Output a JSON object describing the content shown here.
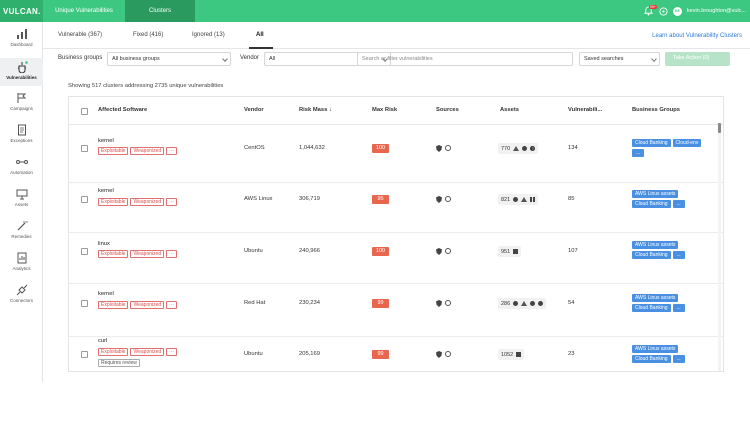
{
  "brand": {
    "logo": "VULCAN.",
    "accent": "#3dc881"
  },
  "top_tabs": [
    {
      "label": "Unique Vulnerabilities",
      "active": false
    },
    {
      "label": "Clusters",
      "active": true
    }
  ],
  "header": {
    "notification_badge": "99+",
    "avatar_initials": "KE",
    "user": "kevin.broughton@vulc..."
  },
  "sidebar": [
    {
      "label": "Dashboard",
      "icon": "bar-chart-icon",
      "active": false
    },
    {
      "label": "Vulnerabilities",
      "icon": "bug-icon",
      "active": true
    },
    {
      "label": "Campaigns",
      "icon": "flag-icon",
      "active": false
    },
    {
      "label": "Exceptions",
      "icon": "document-icon",
      "active": false
    },
    {
      "label": "Automation",
      "icon": "workflow-icon",
      "active": false
    },
    {
      "label": "Assets",
      "icon": "monitor-icon",
      "active": false
    },
    {
      "label": "Remedies",
      "icon": "wand-icon",
      "active": false
    },
    {
      "label": "Analytics",
      "icon": "report-icon",
      "active": false
    },
    {
      "label": "Connectors",
      "icon": "plug-icon",
      "active": false
    }
  ],
  "subtabs": [
    {
      "label": "Vulnerable (367)",
      "active": false
    },
    {
      "label": "Fixed (416)",
      "active": false
    },
    {
      "label": "Ignored (13)",
      "active": false
    },
    {
      "label": "All",
      "active": true
    }
  ],
  "learn_link": "Learn about Vulnerability Clusters",
  "filters": {
    "business_groups_label": "Business groups",
    "business_groups_value": "All business groups",
    "vendor_label": "Vendor",
    "vendor_value": "All",
    "search_placeholder": "Search or filter vulnerabilities",
    "saved_searches": "Saved searches",
    "take_action": "Take Action (0)"
  },
  "showing_text": "Showing 517 clusters addressing 2735 unique vulnerabilities",
  "table": {
    "columns": [
      "Affected Software",
      "Vendor",
      "Risk Mass",
      "Max Risk",
      "Sources",
      "Assets",
      "Vulnerabili...",
      "Business Groups"
    ],
    "rows": [
      {
        "software": "kernel",
        "tags": [
          "Exploitable",
          "Weaponized"
        ],
        "extra_tag": "",
        "vendor": "CentOS",
        "risk_mass": "1,044,632",
        "max_risk": "100",
        "risk_color": "#e8664e",
        "assets": "770",
        "asset_icons": [
          "tri",
          "cog",
          "q"
        ],
        "vulns": "134",
        "groups": [
          [
            "Cloud Banking",
            "Cloud-env"
          ],
          [
            "..."
          ]
        ]
      },
      {
        "software": "kernel",
        "tags": [
          "Exploitable",
          "Weaponized"
        ],
        "extra_tag": "",
        "vendor": "AWS Linux",
        "risk_mass": "306,719",
        "max_risk": "95",
        "risk_color": "#e8664e",
        "assets": "821",
        "asset_icons": [
          "circ",
          "tri",
          "win"
        ],
        "vulns": "85",
        "groups": [
          [
            "AWS Linux assets"
          ],
          [
            "Cloud Banking",
            "..."
          ]
        ]
      },
      {
        "software": "linux",
        "tags": [
          "Exploitable",
          "Weaponized"
        ],
        "extra_tag": "",
        "vendor": "Ubuntu",
        "risk_mass": "240,966",
        "max_risk": "100",
        "risk_color": "#e8664e",
        "assets": "951",
        "asset_icons": [
          "sq"
        ],
        "vulns": "107",
        "groups": [
          [
            "AWS Linux assets"
          ],
          [
            "Cloud Banking",
            "..."
          ]
        ]
      },
      {
        "software": "kernel",
        "tags": [
          "Exploitable",
          "Weaponized"
        ],
        "extra_tag": "",
        "vendor": "Red Hat",
        "risk_mass": "230,234",
        "max_risk": "99",
        "risk_color": "#e8664e",
        "assets": "286",
        "asset_icons": [
          "circ",
          "tri",
          "cog",
          "cog"
        ],
        "vulns": "54",
        "groups": [
          [
            "AWS Linux assets"
          ],
          [
            "Cloud Banking",
            "..."
          ]
        ]
      },
      {
        "software": "curl",
        "tags": [
          "Exploitable",
          "Weaponized"
        ],
        "extra_tag": "Requires review",
        "vendor": "Ubuntu",
        "risk_mass": "205,169",
        "max_risk": "99",
        "risk_color": "#e8664e",
        "assets": "1052",
        "asset_icons": [
          "sq"
        ],
        "vulns": "23",
        "groups": [
          [
            "AWS Linux assets"
          ],
          [
            "Cloud Banking",
            "..."
          ]
        ]
      }
    ]
  }
}
